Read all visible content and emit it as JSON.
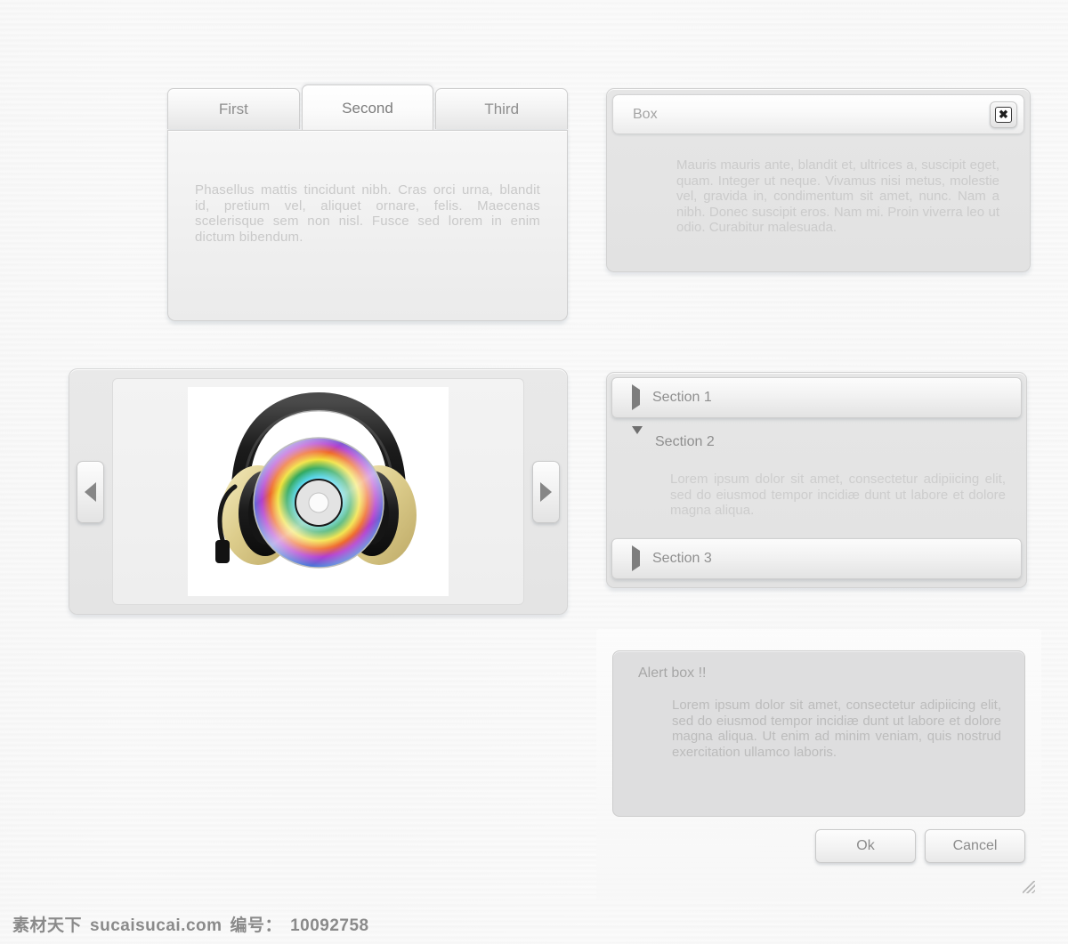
{
  "tabs_widget": {
    "tabs": [
      {
        "label": "First",
        "active": false
      },
      {
        "label": "Second",
        "active": true
      },
      {
        "label": "Third",
        "active": false
      }
    ],
    "panel_text": "Phasellus mattis tincidunt nibh. Cras orci urna, blandit id, pretium vel, aliquet ornare, felis. Maecenas scelerisque sem non nisl. Fusce sed lorem in enim dictum bibendum."
  },
  "box_widget": {
    "title": "Box",
    "close_icon": "close-x-icon",
    "close_glyph": "✖",
    "body_text": "Mauris mauris ante, blandit et, ultrices a, suscipit eget, quam. Integer ut neque. Vivamus nisi metus, molestie vel, gravida in, condimentum sit amet, nunc. Nam a nibh. Donec suscipit eros. Nam mi. Proin viverra leo ut odio. Curabitur malesuada."
  },
  "carousel_widget": {
    "prev_icon": "arrow-left-icon",
    "next_icon": "arrow-right-icon",
    "slide_alt": "headphones-with-cd-image"
  },
  "accordion_widget": {
    "sections": [
      {
        "title": "Section 1",
        "expanded": false,
        "arrow_icon": "triangle-right-icon",
        "body": ""
      },
      {
        "title": "Section 2",
        "expanded": true,
        "arrow_icon": "triangle-down-icon",
        "body": "Lorem ipsum dolor sit amet, consectetur adipiicing elit, sed do eiusmod tempor incidiæ dunt ut labore et dolore magna aliqua."
      },
      {
        "title": "Section 3",
        "expanded": false,
        "arrow_icon": "triangle-right-icon",
        "body": ""
      }
    ]
  },
  "dialog_widget": {
    "alert_title": "Alert box !!",
    "alert_text": "Lorem ipsum dolor sit amet, consectetur adipiicing elit, sed do eiusmod tempor incidiæ dunt ut labore et dolore magna aliqua. Ut enim ad minim veniam, quis nostrud exercitation ullamco laboris.",
    "ok_label": "Ok",
    "cancel_label": "Cancel",
    "resize_icon": "resize-grip-icon"
  },
  "watermark": {
    "site_cn": "素材天下",
    "site_url": "sucaisucai.com",
    "id_label": "编号：",
    "id_value": "10092758"
  },
  "colors": {
    "background": "#f2f2f2",
    "panel_face": "#e4e4e4",
    "text_muted": "#c9c9c9",
    "text_label": "#8e8e8e",
    "border": "#d0d0d0"
  }
}
